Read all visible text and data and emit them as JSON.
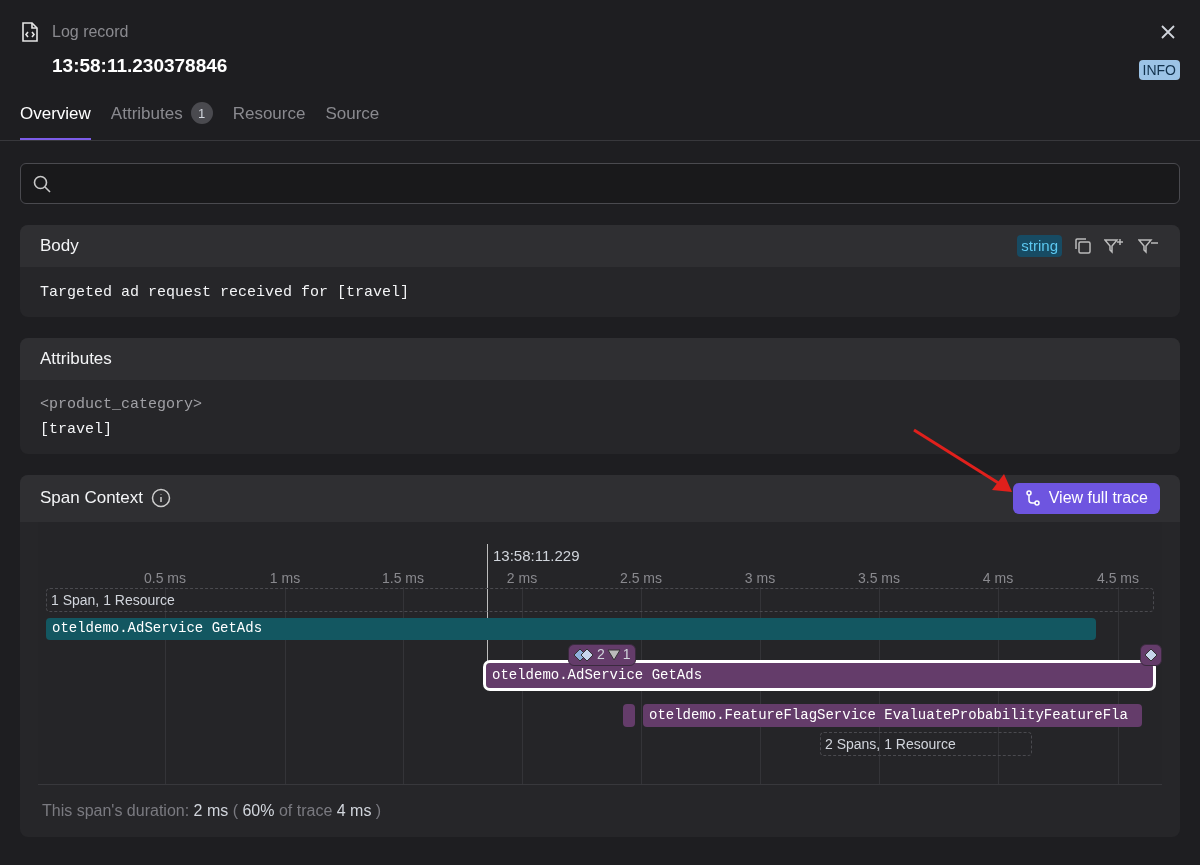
{
  "header": {
    "kind_label": "Log record",
    "timestamp": "13:58:11.230378846",
    "severity": "INFO"
  },
  "tabs": [
    {
      "label": "Overview",
      "selected": true
    },
    {
      "label": "Attributes",
      "count": "1",
      "selected": false
    },
    {
      "label": "Resource",
      "selected": false
    },
    {
      "label": "Source",
      "selected": false
    }
  ],
  "body": {
    "title": "Body",
    "type_badge": "string",
    "text": "Targeted ad request received for [travel]"
  },
  "attributes": {
    "title": "Attributes",
    "lines": [
      "<product_category>",
      "[travel]"
    ]
  },
  "span_context": {
    "title": "Span Context",
    "button": "View full trace",
    "cursor_label": "13:58:11.229",
    "ticks": [
      "0.5 ms",
      "1 ms",
      "1.5 ms",
      "2 ms",
      "2.5 ms",
      "3 ms",
      "3.5 ms",
      "4 ms",
      "4.5 ms"
    ],
    "groups": [
      "1 Span, 1 Resource",
      "2 Spans, 1 Resource"
    ],
    "spans": [
      {
        "name": "oteldemo.AdService GetAds",
        "color": "#135761",
        "selected": false
      },
      {
        "name": "oteldemo.AdService GetAds",
        "color": "#643c6a",
        "selected": true
      },
      {
        "color": "#643c6a",
        "selected": false
      },
      {
        "name": "oteldemo.FeatureFlagService EvaluateProbabilityFeatureFla",
        "color": "#643c6a",
        "selected": false
      }
    ],
    "badge": {
      "left_count": "2",
      "right_count": "1"
    },
    "footer": "This span's duration: **2 ms** ( **60%** of trace **4 ms** )"
  }
}
